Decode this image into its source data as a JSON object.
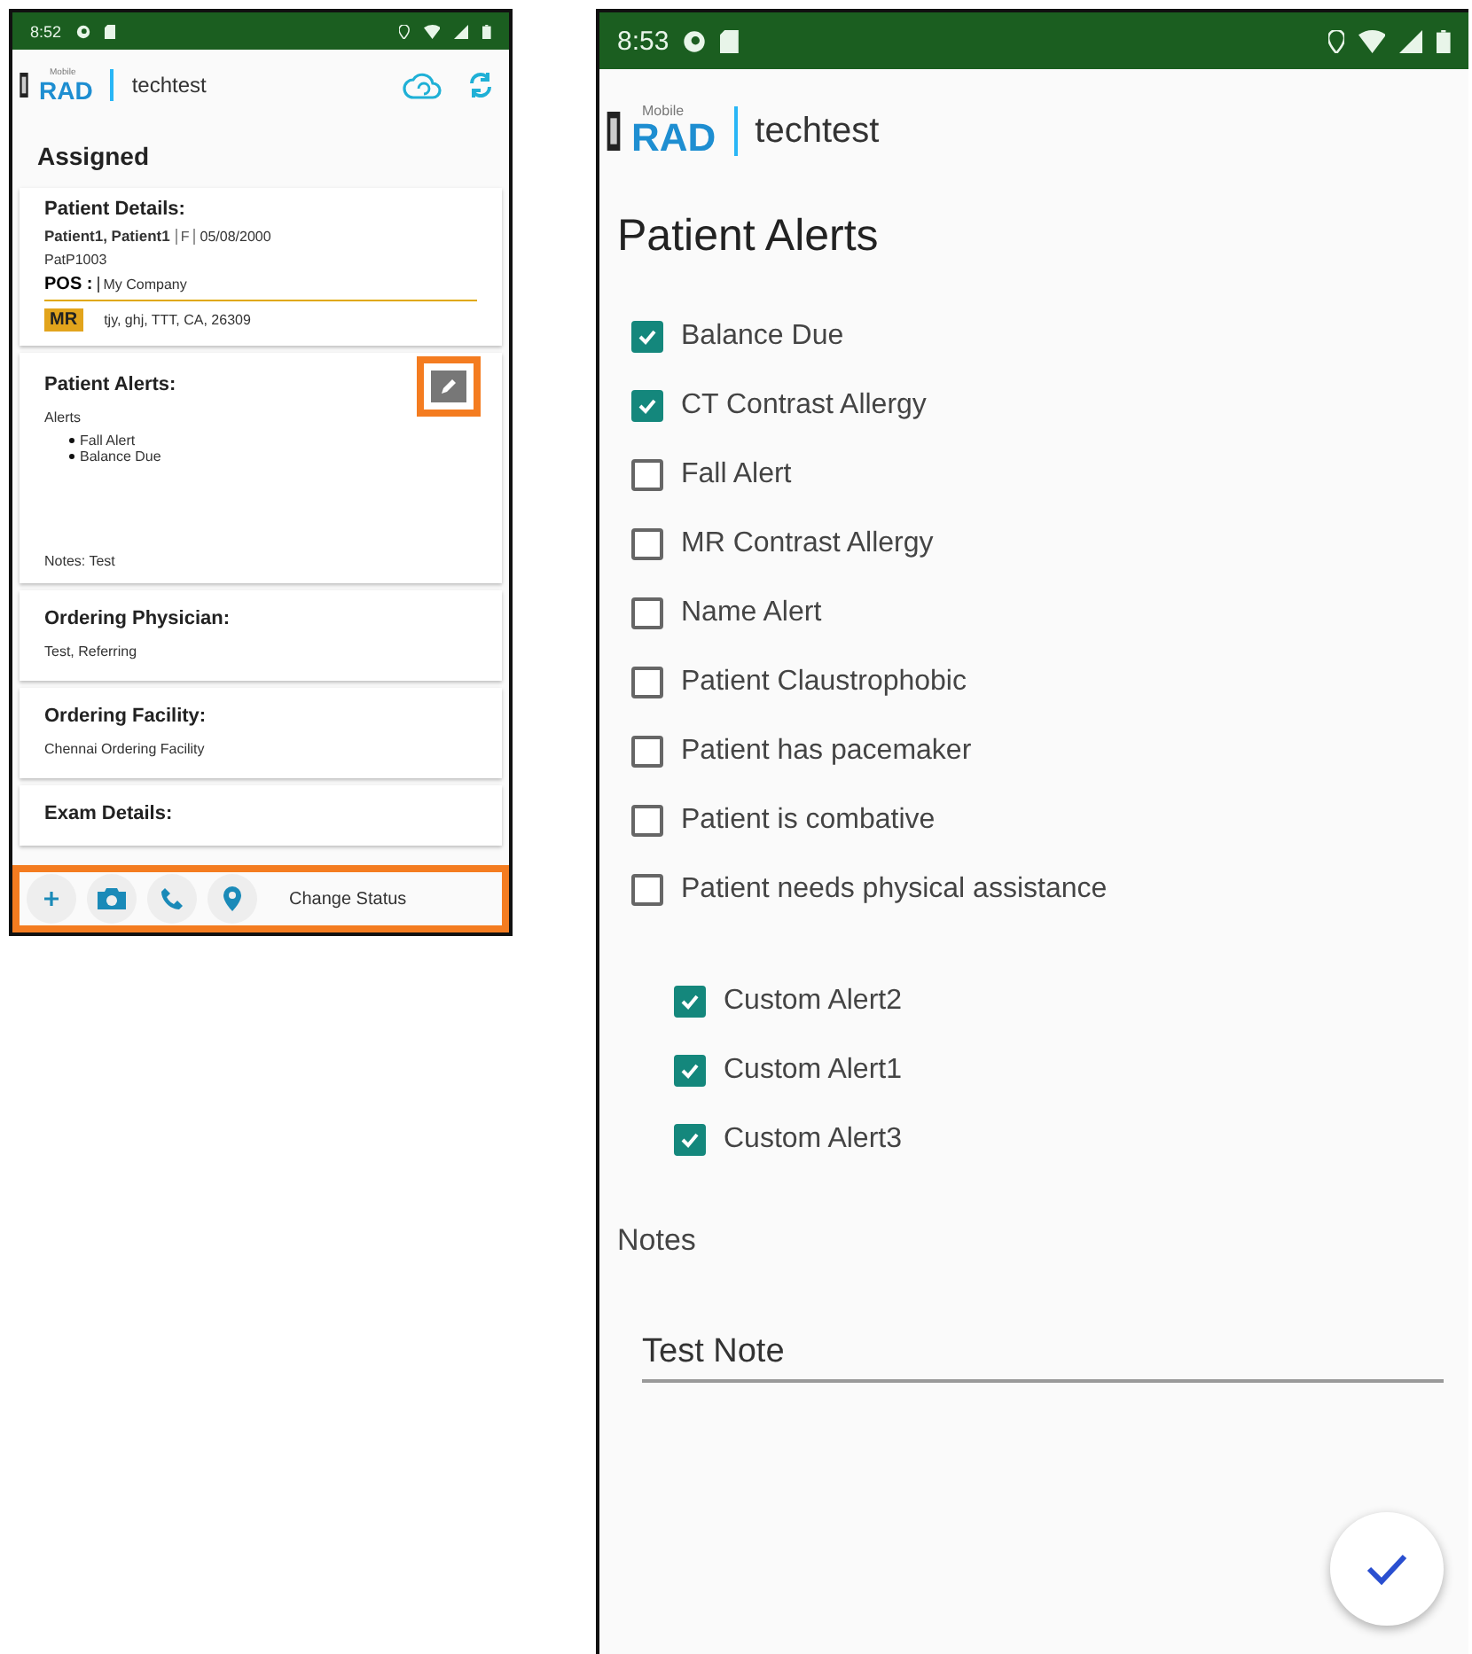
{
  "left_screen": {
    "status_bar": {
      "time": "8:52"
    },
    "app_bar": {
      "brand_small": "Mobile",
      "brand": "RAD",
      "account": "techtest"
    },
    "heading": "Assigned",
    "patient_details": {
      "title": "Patient Details:",
      "name": "Patient1, Patient1",
      "sex": "F",
      "dob": "05/08/2000",
      "patient_id": "PatP1003",
      "pos_label": "POS :",
      "pos_value": "My Company",
      "modality": "MR",
      "address": "tjy, ghj, TTT, CA, 26309"
    },
    "patient_alerts": {
      "title": "Patient Alerts:",
      "label": "Alerts",
      "items": [
        "Fall Alert",
        "Balance Due"
      ],
      "notes": "Notes: Test"
    },
    "cards": [
      {
        "title": "Ordering Physician:",
        "value": "Test, Referring"
      },
      {
        "title": "Ordering Facility:",
        "value": "Chennai Ordering Facility"
      },
      {
        "title": "Exam Details:"
      }
    ],
    "bottom_bar": {
      "label": "Change Status"
    }
  },
  "right_screen": {
    "status_bar": {
      "time": "8:53"
    },
    "app_bar": {
      "brand_small": "Mobile",
      "brand": "RAD",
      "account": "techtest"
    },
    "title": "Patient Alerts",
    "alerts": [
      {
        "label": "Balance Due",
        "checked": true
      },
      {
        "label": "CT Contrast Allergy",
        "checked": true
      },
      {
        "label": "Fall Alert",
        "checked": false
      },
      {
        "label": "MR Contrast Allergy",
        "checked": false
      },
      {
        "label": "Name Alert",
        "checked": false
      },
      {
        "label": "Patient Claustrophobic",
        "checked": false
      },
      {
        "label": "Patient has pacemaker",
        "checked": false
      },
      {
        "label": "Patient is combative",
        "checked": false
      },
      {
        "label": "Patient needs physical assistance",
        "checked": false
      }
    ],
    "custom_alerts": [
      {
        "label": "Custom Alert2",
        "checked": true
      },
      {
        "label": "Custom Alert1",
        "checked": true
      },
      {
        "label": "Custom Alert3",
        "checked": true
      }
    ],
    "notes_label": "Notes",
    "notes_value": "Test Note"
  }
}
